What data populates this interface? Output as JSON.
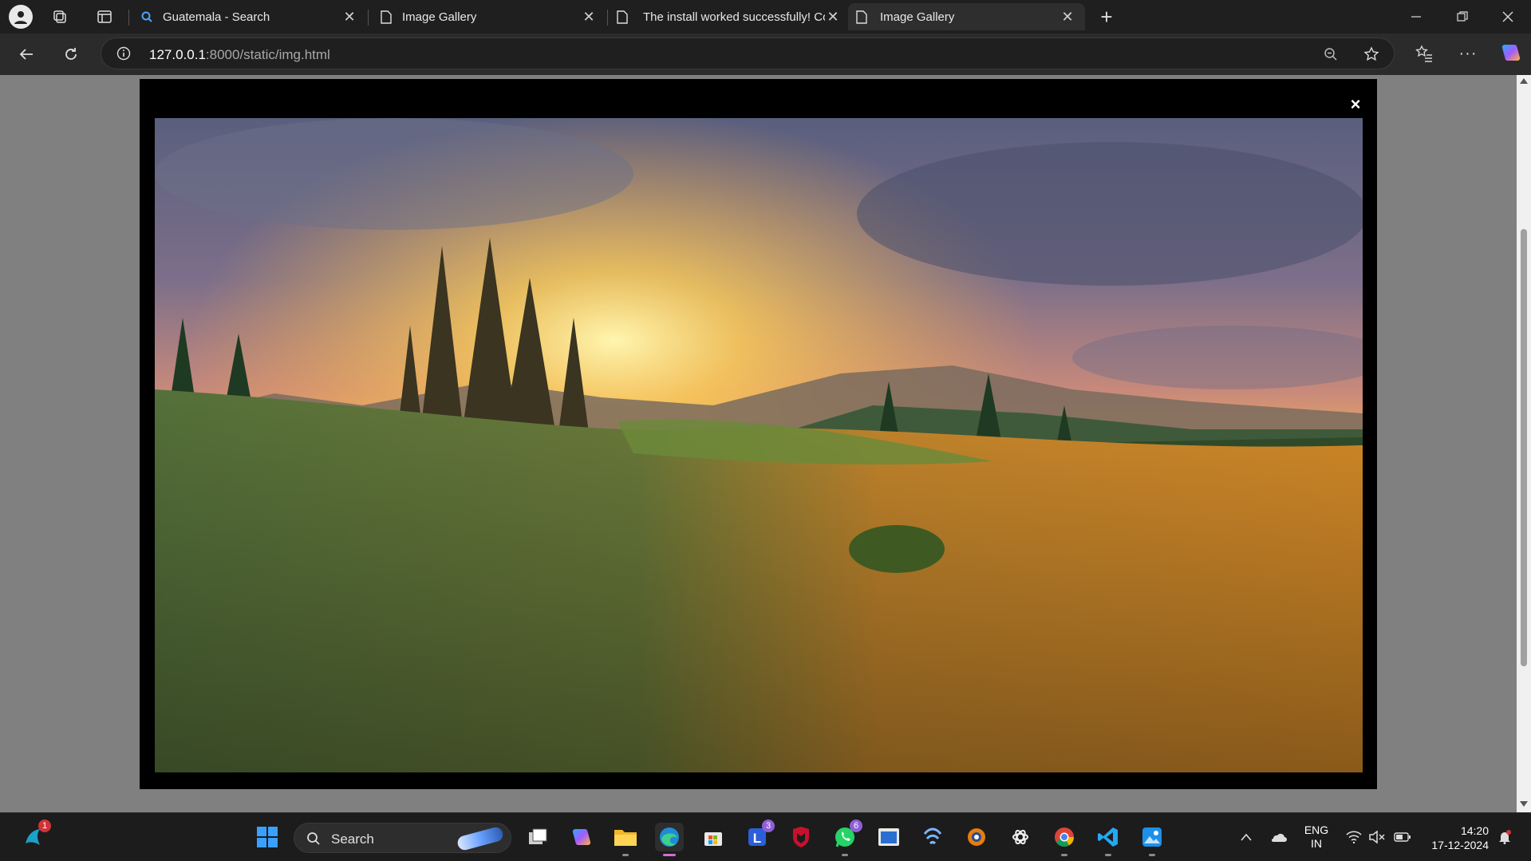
{
  "tabs": [
    {
      "title": "Guatemala - Search",
      "icon": "search-icon"
    },
    {
      "title": "Image Gallery",
      "icon": "page-icon"
    },
    {
      "title": "The install worked successfully! Co",
      "icon": "page-icon"
    },
    {
      "title": "Image Gallery",
      "icon": "page-icon",
      "active": true
    }
  ],
  "address": {
    "host": "127.0.0.1",
    "path": ":8000/static/img.html"
  },
  "modal": {
    "close_label": "×",
    "image_subject": "mountain meadow at sunset"
  },
  "taskbar": {
    "search_label": "Search",
    "badges": {
      "copilot_sys": "1",
      "teams": "3",
      "whatsapp": "6"
    },
    "language": "ENG",
    "region": "IN",
    "time": "14:20",
    "date": "17-12-2024"
  },
  "colors": {
    "accent": "#0078d4",
    "modal_bg": "#000000",
    "page_bg": "#808080"
  }
}
